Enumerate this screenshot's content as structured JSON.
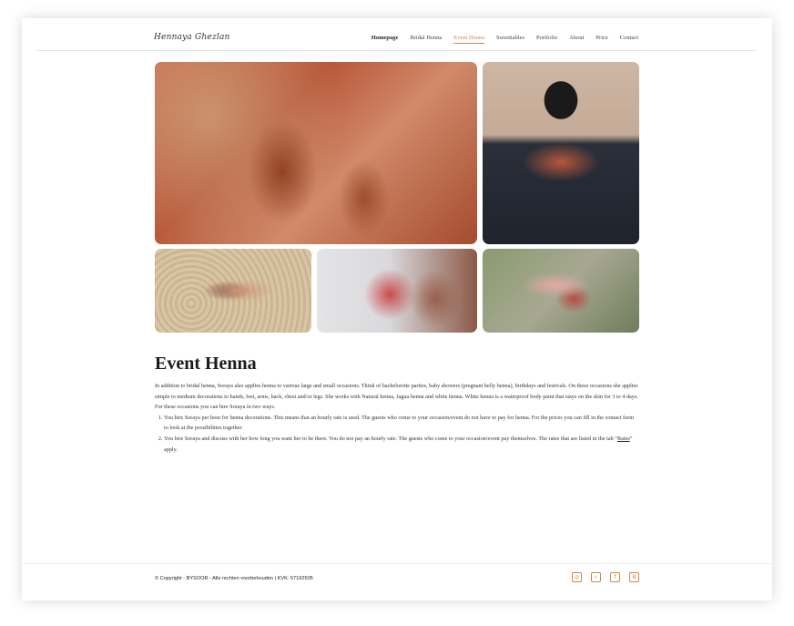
{
  "header": {
    "logo": "Hennaya Ghezlan",
    "nav": [
      "Homepage",
      "Bridal Henna",
      "Event Henna",
      "Sweettables",
      "Portfolio",
      "About",
      "Price",
      "Contact"
    ]
  },
  "main": {
    "title": "Event Henna",
    "intro": "In addition to bridal henna, Soraya also applies henna to various large and small occasions. Think of bachelorette parties, baby showers (pregnant belly henna), birthdays and festivals. On these occasions she applies simple to medium decorations to hands, feet, arms, back, chest and/or legs. She works with Natural henna, Jagua henna and white henna. White henna is a waterproof body paint that stays on the skin for 3 to 4 days.",
    "ways_intro": "For these occasions you can hire Soraya in two ways.",
    "way1": "You hire Soraya per hour for henna decorations. This means that an hourly rate is used. The guests who come to your occasion/event do not have to pay for henna. For the prices you can fill in the contact form to look at the possibilities together.",
    "way2_before": "You hire Soraya and discuss with her how long you want her to be there. You do not pay an hourly rate. The guests who come to your occasion/event pay themselves. The rates that are listed in the tab “",
    "way2_link": "Rates",
    "way2_after": "” apply."
  },
  "footer": {
    "copyright": "© Copyright - BYSOOR - Alle rechten voorbehouden | KVK: 57192505",
    "socials": [
      "instagram-icon",
      "twitter-icon",
      "facebook-icon",
      "blog-icon"
    ],
    "social_glyphs": [
      "◎",
      "✓",
      "f",
      "B"
    ]
  },
  "colors": {
    "accent": "#c58b4c"
  }
}
